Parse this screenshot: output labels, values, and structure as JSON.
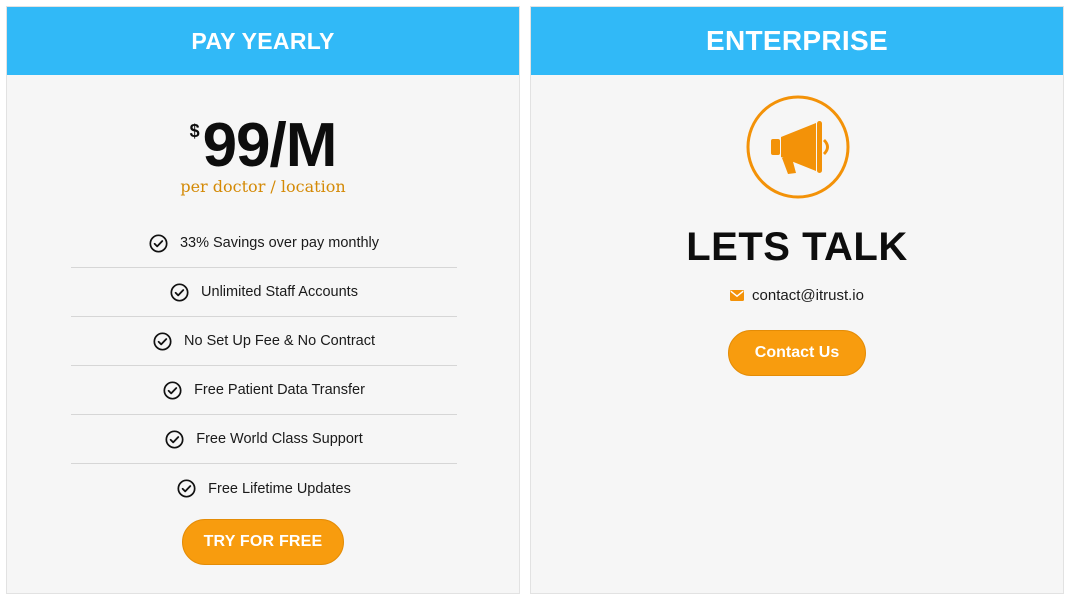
{
  "pay_yearly": {
    "header": "PAY YEARLY",
    "currency": "$",
    "price": "99/M",
    "price_note": "per doctor / location",
    "features": [
      "33% Savings over pay monthly",
      "Unlimited Staff Accounts",
      "No Set Up Fee & No Contract",
      "Free Patient Data Transfer",
      "Free World Class Support",
      "Free Lifetime Updates"
    ],
    "button_label": "TRY FOR FREE"
  },
  "enterprise": {
    "header": "ENTERPRISE",
    "icon": "megaphone-icon",
    "title": "LETS TALK",
    "contact_email": "contact@itrust.io",
    "button_label": "Contact Us"
  },
  "colors": {
    "header_blue": "#31b9f7",
    "accent_orange": "#f89c0e",
    "card_bg": "#f6f6f6"
  }
}
